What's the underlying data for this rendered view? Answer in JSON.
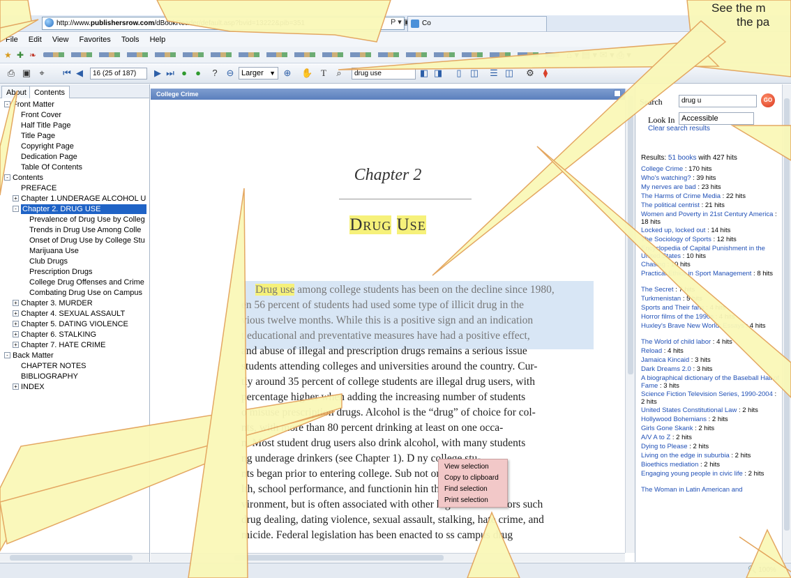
{
  "browser": {
    "url_prefix": "http://www.",
    "url_host": "publishersrow.com",
    "url_path": "/dBookReader/default.asp?bvid=13222&pib=351",
    "url_tools": "P ▾ ▣ C ✕",
    "tab_label": "Co",
    "menu": [
      "File",
      "Edit",
      "View",
      "Favorites",
      "Tools",
      "Help"
    ]
  },
  "reader_toolbar": {
    "page_indicator": "16 (25 of 187)",
    "zoom_value": "Larger",
    "search_value": "drug use"
  },
  "toc": {
    "tabs": [
      "About",
      "Contents"
    ],
    "items": [
      {
        "label": "Front Matter",
        "exp": "-"
      },
      {
        "label": "Front Cover",
        "exp": ""
      },
      {
        "label": "Half Title Page",
        "exp": ""
      },
      {
        "label": "Title Page",
        "exp": ""
      },
      {
        "label": "Copyright Page",
        "exp": ""
      },
      {
        "label": "Dedication Page",
        "exp": ""
      },
      {
        "label": "Table Of Contents",
        "exp": ""
      },
      {
        "label": "Contents",
        "exp": "-"
      },
      {
        "label": "PREFACE",
        "exp": ""
      },
      {
        "label": "Chapter 1.UNDERAGE ALCOHOL U",
        "exp": "+"
      },
      {
        "label": "Chapter 2. DRUG USE",
        "exp": "-",
        "selected": true
      },
      {
        "label": "Prevalence of Drug Use by Colleg",
        "exp": ""
      },
      {
        "label": "Trends in Drug Use Among Colle",
        "exp": ""
      },
      {
        "label": "Onset of Drug Use by College Stu",
        "exp": ""
      },
      {
        "label": "Marijuana Use",
        "exp": ""
      },
      {
        "label": "Club Drugs",
        "exp": ""
      },
      {
        "label": "Prescription Drugs",
        "exp": ""
      },
      {
        "label": "College Drug Offenses and Crime",
        "exp": ""
      },
      {
        "label": "Combating Drug Use on Campus",
        "exp": ""
      },
      {
        "label": "Chapter 3. MURDER",
        "exp": "+"
      },
      {
        "label": "Chapter 4. SEXUAL ASSAULT",
        "exp": "+"
      },
      {
        "label": "Chapter 5. DATING VIOLENCE",
        "exp": "+"
      },
      {
        "label": "Chapter 6. STALKING",
        "exp": "+"
      },
      {
        "label": "Chapter 7. HATE CRIME",
        "exp": "+"
      },
      {
        "label": "Back Matter",
        "exp": "-"
      },
      {
        "label": "CHAPTER NOTES",
        "exp": ""
      },
      {
        "label": "BIBLIOGRAPHY",
        "exp": ""
      },
      {
        "label": "INDEX",
        "exp": "+"
      }
    ]
  },
  "viewer": {
    "title": "College Crime",
    "chapter_label": "Chapter 2",
    "chapter_title_1": "Drug",
    "chapter_title_2": "Use",
    "highlight_1": "Drug use",
    "line_1_rest": " among college students has been on the decline since 1980,",
    "lines": [
      "en 56 percent of students had used some type of illicit drug in the",
      "vious twelve months. While this is a positive sign and an indication",
      "t educational and preventative measures have had a positive effect,",
      "and abuse of illegal and prescription drugs remains a serious issue",
      "students attending colleges and universities around the country. Cur-",
      "tly around 35 percent of college students are illegal drug users, with",
      "percentage higher when adding the increasing number of students",
      "o misuse prescription drugs. Alcohol is the “drug” of choice for col-",
      "nts, with more than 80 percent drinking at least on one occa-",
      "n. Most student drug users also drink alcohol, with many students",
      "ng underage drinkers (see Chapter 1). D               ny college stu-",
      "nts began prior to entering college. Sub             not only affects",
      "lth, school performance, and functionin              hin the college",
      "vironment, but is often associated with other high-risk behaviors such",
      "drug dealing, dating violence, sexual assault, stalking, hate crime, and",
      "micide. Federal legislation has been enacted to    ss campus drug"
    ]
  },
  "context_menu": [
    "View selection",
    "Copy to clipboard",
    "Find selection",
    "Print selection"
  ],
  "search_panel": {
    "search_label": "Search",
    "search_value": "drug u",
    "go_label": "GO",
    "look_in_label": "Look In",
    "look_in_value": "Accessible",
    "clear_label": "Clear search results",
    "results_prefix": "Results: ",
    "results_books": "51 books",
    "results_suffix": " with 427 hits",
    "results": [
      {
        "title": "College Crime",
        "hits": " : 170 hits",
        "lines": 1
      },
      {
        "title": "Who's watching?",
        "hits": " : 39 hits",
        "lines": 1
      },
      {
        "title": "My nerves are bad",
        "hits": " : 23 hits",
        "lines": 1
      },
      {
        "title": "The Harms of Crime Media",
        "hits": " : 22 hits",
        "lines": 1
      },
      {
        "title": "The political centrist",
        "hits": " : 21 hits",
        "lines": 1
      },
      {
        "title": "Women and Poverty in 21st Century America",
        "hits": " : 18 hits",
        "lines": 2
      },
      {
        "title": "Locked up, locked out",
        "hits": " : 14 hits",
        "lines": 1
      },
      {
        "title": "The Sociology of Sports",
        "hits": " : 12 hits",
        "lines": 1
      },
      {
        "title": "Encyclopedia of Capital Punishment in the United States",
        "hits": " : 10 hits",
        "lines": 2
      },
      {
        "title": "Chasing",
        "hits": " : 10 hits",
        "lines": 1
      },
      {
        "title": "Practical Ethics in Sport Management",
        "hits": " : 8 hits",
        "lines": 2
      },
      {
        "title": "The Secret",
        "hits": " : 7 hits",
        "lines": 1
      },
      {
        "title": "Turkmenistan",
        "hits": " : 5 hits",
        "lines": 1
      },
      {
        "title": "Sports and Their fans",
        "hits": " : 4 hits",
        "lines": 1
      },
      {
        "title": "Horror films of the 1990s",
        "hits": " : 4 hits",
        "lines": 1
      },
      {
        "title": "Huxley's Brave New World: Essays",
        "hits": " : 4 hits",
        "lines": 2
      },
      {
        "title": "The World of child labor",
        "hits": " : 4 hits",
        "lines": 1
      },
      {
        "title": "Reload",
        "hits": " : 4 hits",
        "lines": 1
      },
      {
        "title": "Jamaica Kincaid",
        "hits": " : 3 hits",
        "lines": 1
      },
      {
        "title": "Dark Dreams 2.0",
        "hits": " : 3 hits",
        "lines": 1
      },
      {
        "title": "A biographical dictionary of the Baseball Hall of Fame",
        "hits": " : 3 hits",
        "lines": 2
      },
      {
        "title": "Science Fiction Television Series, 1990-2004",
        "hits": " : 2 hits",
        "lines": 2
      },
      {
        "title": "United States Constitutional Law",
        "hits": " : 2 hits",
        "lines": 1
      },
      {
        "title": "Hollywood Bohemians",
        "hits": " : 2 hits",
        "lines": 1
      },
      {
        "title": "Girls Gone Skank",
        "hits": " : 2 hits",
        "lines": 1
      },
      {
        "title": "A/V A to Z",
        "hits": " : 2 hits",
        "lines": 1
      },
      {
        "title": "Dying to Please",
        "hits": " : 2 hits",
        "lines": 1
      },
      {
        "title": "Living on the edge in suburbia",
        "hits": " : 2 hits",
        "lines": 1
      },
      {
        "title": "Bioethics mediation",
        "hits": " : 2 hits",
        "lines": 1
      },
      {
        "title": "Engaging young people in civic life",
        "hits": " : 2 hits",
        "lines": 2
      },
      {
        "title": "The Woman in Latin American and",
        "hits": "",
        "lines": 1
      }
    ]
  },
  "status": {
    "zoom": "100%"
  },
  "callout": {
    "text": "See the m",
    "text2": "the pa"
  },
  "colors": {
    "callout_fill": "#faf8b8",
    "callout_stroke": "#e3a35a",
    "highlight": "#f6f17a",
    "selection": "#d8e6f5",
    "link": "#1f4fb6"
  }
}
